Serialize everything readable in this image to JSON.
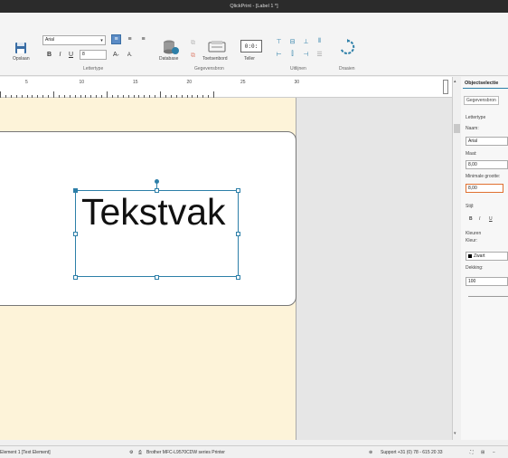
{
  "window": {
    "title": "QlickPrint - [Label 1 *]"
  },
  "ribbon": {
    "save_label": "Opslaan",
    "font_name": "Arial",
    "font_size": "8",
    "group_font": "Lettertype",
    "database_label": "Database",
    "keyboard_label": "Toetsenbord",
    "counter_label": "Teller",
    "counter_display": "0:0:",
    "group_data": "Gegevensbron",
    "group_align": "Uitlijnen",
    "group_rotate": "Draaien"
  },
  "ruler": {
    "ticks": [
      "5",
      "10",
      "15",
      "20",
      "25",
      "30"
    ]
  },
  "canvas": {
    "text_element": "Tekstvak"
  },
  "panel": {
    "title": "Objectselectie",
    "tab_data": "Gegevensbron",
    "section_font": "Lettertype",
    "name_label": "Naam:",
    "name_value": "Arial",
    "size_label": "Maat:",
    "size_value": "8,00",
    "min_size_label": "Minimale grootte:",
    "min_size_value": "8,00",
    "style_label": "Stijl:",
    "bold": "B",
    "italic": "I",
    "underline": "U",
    "colors_section": "Kleuren",
    "color_label": "Kleur:",
    "color_value": "Zwart",
    "opacity_label": "Dekking:",
    "opacity_value": "100"
  },
  "status": {
    "element": "Element 1 [Text Element]",
    "printer": "Brother MFC-L9570CDW series Printer",
    "support": "Support +31 (0) 78 - 615 20 33"
  },
  "colors": {
    "accent": "#2d7fa8",
    "paper": "#fdf3d9",
    "highlight_border": "#e07030"
  }
}
